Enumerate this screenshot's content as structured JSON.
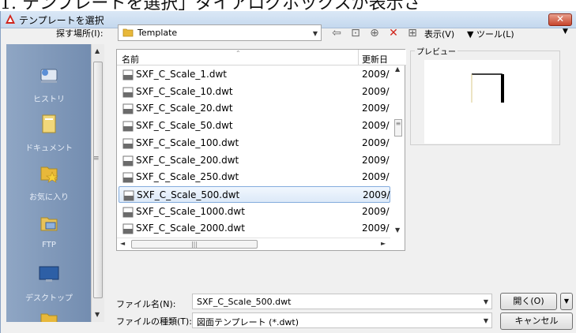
{
  "background_text": "1. テンプレートを選択」ダイアログボックスが表示さ",
  "window": {
    "title": "テンプレートを選択",
    "close_label": "✕"
  },
  "toolbar": {
    "look_in_label": "探す場所(I):",
    "look_in_value": "Template",
    "views_label": "表示(V)",
    "tools_label": "▼ ツール(L)"
  },
  "places": [
    {
      "label": "ヒストリ",
      "icon": "history-icon"
    },
    {
      "label": "ドキュメント",
      "icon": "documents-icon"
    },
    {
      "label": "お気に入り",
      "icon": "favorites-icon"
    },
    {
      "label": "FTP",
      "icon": "ftp-icon"
    },
    {
      "label": "デスクトップ",
      "icon": "desktop-icon"
    }
  ],
  "file_list": {
    "columns": {
      "name": "名前",
      "date": "更新日"
    },
    "rows": [
      {
        "name": "SXF_C_Scale_1.dwt",
        "date": "2009/"
      },
      {
        "name": "SXF_C_Scale_10.dwt",
        "date": "2009/"
      },
      {
        "name": "SXF_C_Scale_20.dwt",
        "date": "2009/"
      },
      {
        "name": "SXF_C_Scale_50.dwt",
        "date": "2009/"
      },
      {
        "name": "SXF_C_Scale_100.dwt",
        "date": "2009/"
      },
      {
        "name": "SXF_C_Scale_200.dwt",
        "date": "2009/"
      },
      {
        "name": "SXF_C_Scale_250.dwt",
        "date": "2009/"
      },
      {
        "name": "SXF_C_Scale_500.dwt",
        "date": "2009/"
      },
      {
        "name": "SXF_C_Scale_1000.dwt",
        "date": "2009/"
      },
      {
        "name": "SXF_C_Scale_2000.dwt",
        "date": "2009/"
      }
    ],
    "selected_index": 7
  },
  "preview": {
    "label": "プレビュー"
  },
  "fields": {
    "file_name_label": "ファイル名(N):",
    "file_name_value": "SXF_C_Scale_500.dwt",
    "file_type_label": "ファイルの種類(T):",
    "file_type_value": "図面テンプレート (*.dwt)"
  },
  "buttons": {
    "open": "開く(O)",
    "cancel": "キャンセル"
  },
  "colors": {
    "selection": "#dce9f8",
    "places_bar": "#7f97b8",
    "close": "#c7452c"
  }
}
